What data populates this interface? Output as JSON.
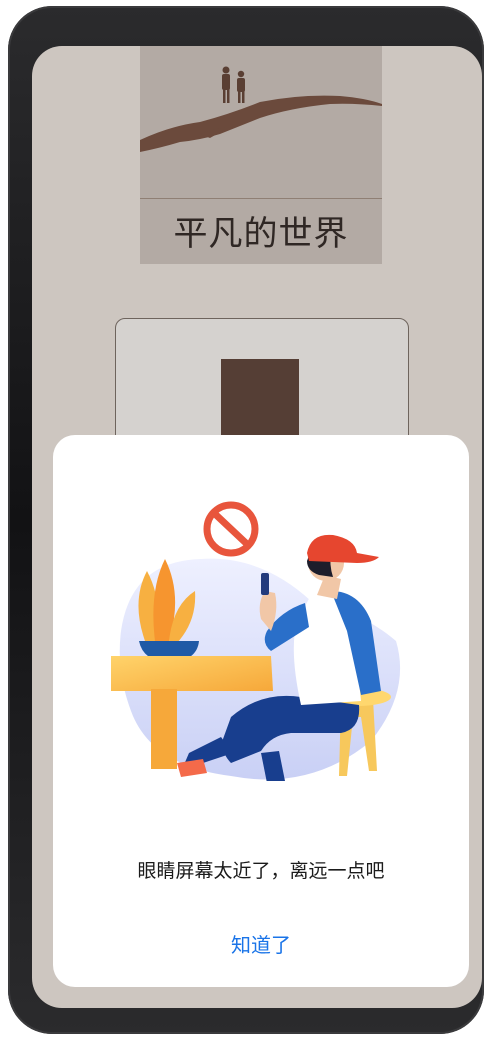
{
  "book": {
    "title": "平凡的世界"
  },
  "dialog": {
    "message": "眼睛屏幕太近了，离远一点吧",
    "confirm_label": "知道了",
    "illustration": "person-using-phone-too-close-illustration"
  },
  "colors": {
    "screen_background": "#cdc6c0",
    "book_cover": "#b3aaa4",
    "accent_blue": "#1a74e8",
    "warning_red": "#e8553c"
  }
}
